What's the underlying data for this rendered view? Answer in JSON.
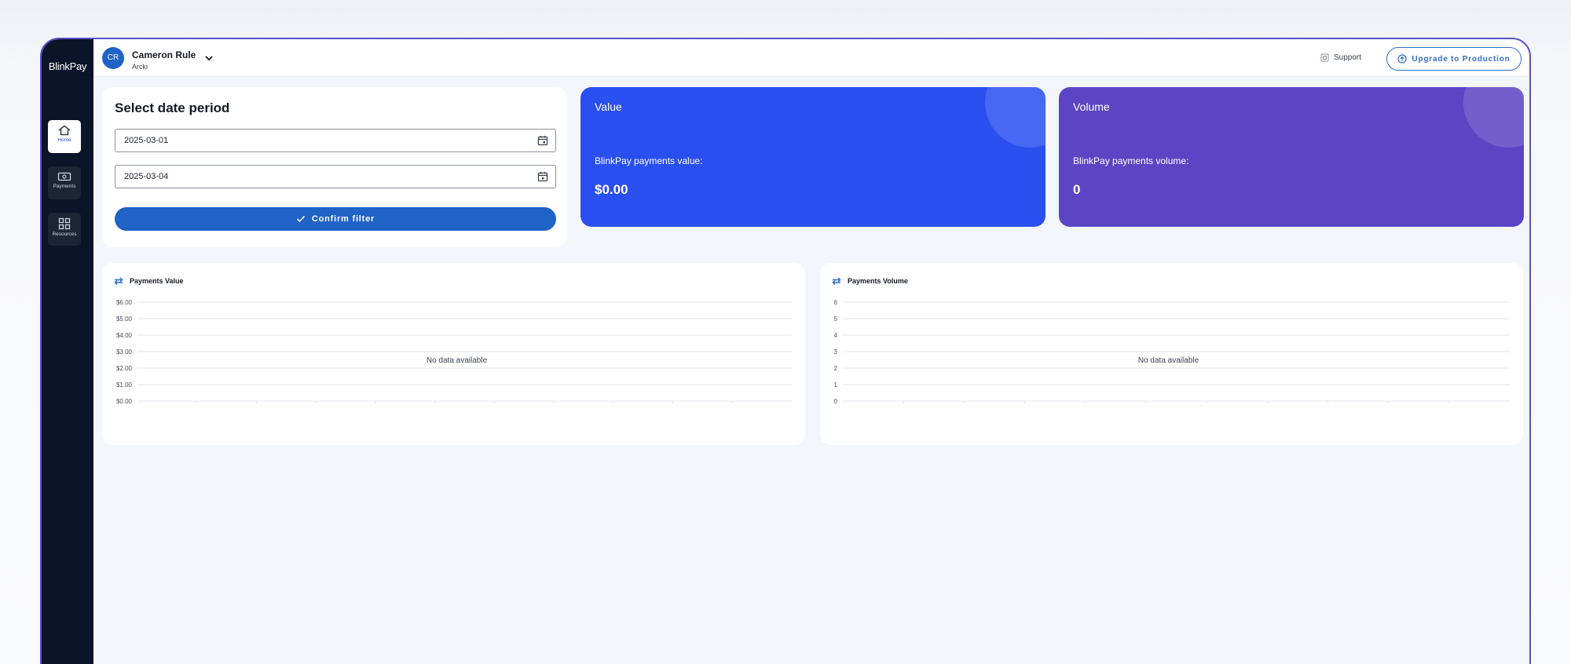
{
  "app": {
    "logo_text_a": "Blink",
    "logo_text_b": "Pay"
  },
  "sidebar": {
    "items": [
      {
        "label": "Home",
        "icon": "home-icon",
        "active": true
      },
      {
        "label": "Payments",
        "icon": "payments-icon",
        "active": false
      },
      {
        "label": "Resources",
        "icon": "resources-icon",
        "active": false
      }
    ]
  },
  "header": {
    "avatar_initials": "CR",
    "user_name": "Cameron Rule",
    "organization": "Arcki",
    "support_label": "Support",
    "upgrade_label": "Upgrade to Production"
  },
  "date_filter": {
    "title": "Select date period",
    "start_date": "2025-03-01",
    "end_date": "2025-03-04",
    "confirm_label": "Confirm filter"
  },
  "stats": {
    "value": {
      "title": "Value",
      "subtitle": "BlinkPay payments value:",
      "amount": "$0.00",
      "color": "#2a4ff0"
    },
    "volume": {
      "title": "Volume",
      "subtitle": "BlinkPay payments volume:",
      "amount": "0",
      "color": "#5b45c4"
    }
  },
  "chart_data": [
    {
      "type": "line",
      "title": "Payments Value",
      "empty_message": "No data available",
      "y_ticks": [
        "$0.00",
        "$1.00",
        "$2.00",
        "$3.00",
        "$4.00",
        "$5.00",
        "$6.00"
      ],
      "ylim": [
        0,
        6
      ],
      "values": [],
      "grid": true
    },
    {
      "type": "line",
      "title": "Payments Volume",
      "empty_message": "No data available",
      "y_ticks": [
        "0",
        "1",
        "2",
        "3",
        "4",
        "5",
        "6"
      ],
      "ylim": [
        0,
        6
      ],
      "values": [],
      "grid": true
    }
  ]
}
